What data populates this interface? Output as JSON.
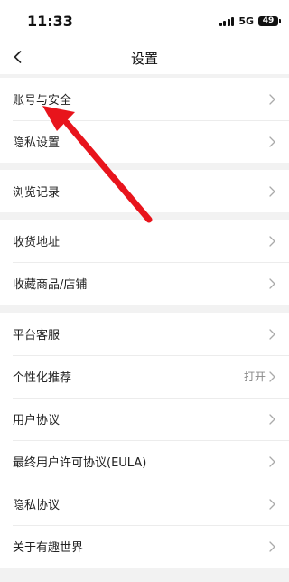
{
  "status_bar": {
    "time": "11:33",
    "network": "5G",
    "battery": "49"
  },
  "header": {
    "title": "设置",
    "back_icon": "chevron-left-icon"
  },
  "groups": [
    {
      "items": [
        {
          "label": "账号与安全"
        },
        {
          "label": "隐私设置"
        }
      ]
    },
    {
      "items": [
        {
          "label": "浏览记录"
        }
      ]
    },
    {
      "items": [
        {
          "label": "收货地址"
        },
        {
          "label": "收藏商品/店铺"
        }
      ]
    },
    {
      "items": [
        {
          "label": "平台客服"
        },
        {
          "label": "个性化推荐",
          "value": "打开"
        },
        {
          "label": "用户协议"
        },
        {
          "label": "最终用户许可协议(EULA)"
        },
        {
          "label": "隐私协议"
        },
        {
          "label": "关于有趣世界"
        }
      ]
    }
  ],
  "annotation": {
    "arrow_color": "#e8141c"
  }
}
